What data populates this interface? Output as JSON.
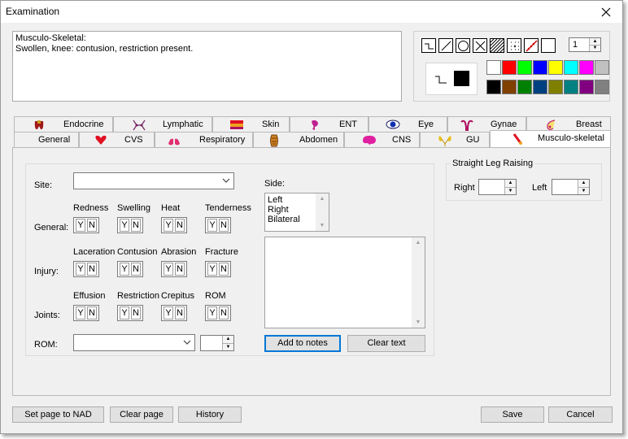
{
  "window": {
    "title": "Examination"
  },
  "notes": {
    "text": "Musculo-Skeletal:\nSwollen, knee: contusion, restriction present."
  },
  "draw_panel": {
    "tools": [
      "step-line-tool",
      "line-tool",
      "circle-tool",
      "cross-tool",
      "hatch-tool",
      "dotted-cross-tool",
      "freehand-tool",
      "eraser-tool"
    ],
    "line_width": "1",
    "selected_color": "#000000",
    "palette_top": [
      "#ffffff",
      "#ff0000",
      "#00ff00",
      "#0000ff",
      "#ffff00",
      "#00ffff",
      "#ff00ff",
      "#c0c0c0"
    ],
    "palette_bottom": [
      "#000000",
      "#804000",
      "#008000",
      "#004080",
      "#808000",
      "#008080",
      "#800080",
      "#808080"
    ]
  },
  "tabs": {
    "row1": [
      {
        "label": "Endocrine",
        "icon": "thyroid-icon"
      },
      {
        "label": "Lymphatic",
        "icon": "lymph-icon"
      },
      {
        "label": "Skin",
        "icon": "skin-icon"
      },
      {
        "label": "ENT",
        "icon": "ear-icon"
      },
      {
        "label": "Eye",
        "icon": "eye-icon"
      },
      {
        "label": "Gynae",
        "icon": "uterus-icon"
      },
      {
        "label": "Breast",
        "icon": "breast-icon"
      }
    ],
    "row2": [
      {
        "label": "General",
        "icon": ""
      },
      {
        "label": "CVS",
        "icon": "heart-icon"
      },
      {
        "label": "Respiratory",
        "icon": "lungs-icon"
      },
      {
        "label": "Abdomen",
        "icon": "abdomen-icon"
      },
      {
        "label": "CNS",
        "icon": "brain-icon"
      },
      {
        "label": "GU",
        "icon": "kidney-icon"
      },
      {
        "label": "Musculo-skeletal",
        "icon": "bone-icon"
      }
    ],
    "active": "Musculo-skeletal"
  },
  "msk": {
    "site_label": "Site:",
    "site_value": "",
    "row_labels": {
      "general": "General:",
      "injury": "Injury:",
      "joints": "Joints:"
    },
    "general": [
      "Redness",
      "Swelling",
      "Heat",
      "Tenderness"
    ],
    "injury": [
      "Laceration",
      "Contusion",
      "Abrasion",
      "Fracture"
    ],
    "joints": [
      "Effusion",
      "Restriction",
      "Crepitus",
      "ROM"
    ],
    "yes": "Y",
    "no": "N",
    "rom_label": "ROM:",
    "rom_value": "",
    "rom_spin_value": "",
    "side_label": "Side:",
    "side_options": [
      "Left",
      "Right",
      "Bilateral"
    ],
    "side_text": "",
    "add_to_notes": "Add to notes",
    "clear_text": "Clear text"
  },
  "slr": {
    "title": "Straight Leg Raising",
    "right_label": "Right",
    "left_label": "Left",
    "right_value": "",
    "left_value": ""
  },
  "footer": {
    "set_nad": "Set page to NAD",
    "clear_page": "Clear page",
    "history": "History",
    "save": "Save",
    "cancel": "Cancel"
  }
}
